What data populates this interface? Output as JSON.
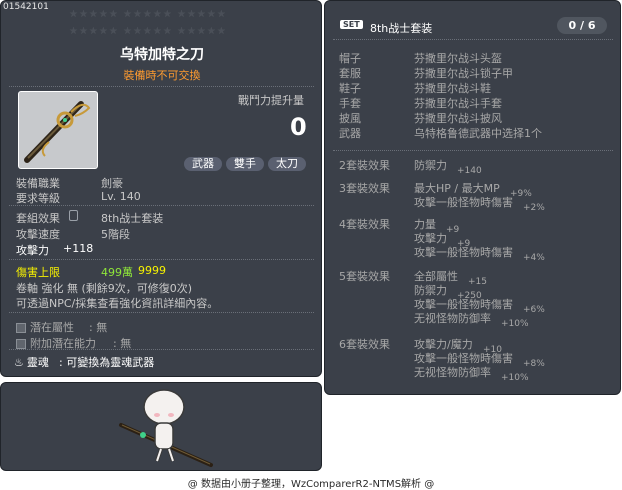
{
  "item_id": "01542101",
  "stars_row1": "★★★★★  ★★★★★  ★★★★★",
  "stars_row2": "★★★★★  ★★★★★  ★★★★★",
  "item_name": "乌特加特之刀",
  "item_tradable": "裝備時不可交換",
  "combat_power_label": "戰鬥力提升量",
  "combat_power_value": "0",
  "tags": [
    "武器",
    "雙手",
    "太刀"
  ],
  "job": {
    "label": "裝備職業",
    "value": "劍豪"
  },
  "level": {
    "label": "要求等級",
    "value": "Lv. 140"
  },
  "set_effect": {
    "label": "套組效果",
    "value": "8th战士套装"
  },
  "attack_speed": {
    "label": "攻擊速度",
    "value": "5階段"
  },
  "attack": {
    "label": "攻擊力",
    "value": "+118"
  },
  "damage_cap": {
    "label": "傷害上限",
    "value1": "499萬",
    "value2": "9999"
  },
  "scroll_line": "卷軸 強化 無 (剩餘9次，可修復0次)",
  "npc_line": "可透過NPC/採集查看強化資訊詳細內容。",
  "potential": {
    "label": "潛在屬性",
    "value": ": 無"
  },
  "add_potential": {
    "label": "附加潛在能力",
    "value": ": 無"
  },
  "soul": {
    "label": "靈魂",
    "value": ": 可變換為靈魂武器"
  },
  "set_panel": {
    "badge": "SET",
    "title": "8th战士套装",
    "count": "0 / 6",
    "parts": [
      {
        "slot": "帽子",
        "name": "芬撒里尔战斗头盔"
      },
      {
        "slot": "套服",
        "name": "芬撒里尔战斗锁子甲"
      },
      {
        "slot": "鞋子",
        "name": "芬撒里尔战斗鞋"
      },
      {
        "slot": "手套",
        "name": "芬撒里尔战斗手套"
      },
      {
        "slot": "披風",
        "name": "芬撒里尔战斗披风"
      },
      {
        "slot": "武器",
        "name": "乌特格鲁德武器中选择1个"
      }
    ],
    "effects": [
      {
        "label": "2套裝效果",
        "lines": [
          [
            "防禦力",
            "+140"
          ]
        ]
      },
      {
        "label": "3套裝效果",
        "lines": [
          [
            "最大HP / 最大MP",
            "+9%"
          ],
          [
            "攻擊一般怪物時傷害",
            "+2%"
          ]
        ]
      },
      {
        "label": "4套裝效果",
        "lines": [
          [
            "力量",
            "+9"
          ],
          [
            "攻擊力",
            "+9"
          ],
          [
            "攻擊一般怪物時傷害",
            "+4%"
          ]
        ]
      },
      {
        "label": "5套裝效果",
        "lines": [
          [
            "全部屬性",
            "+15"
          ],
          [
            "防禦力",
            "+250"
          ],
          [
            "攻擊一般怪物時傷害",
            "+6%"
          ],
          [
            "无视怪物防御率",
            "+10%"
          ]
        ]
      },
      {
        "label": "6套裝效果",
        "lines": [
          [
            "攻擊力/魔力",
            "+10"
          ],
          [
            "攻擊一般怪物時傷害",
            "+8%"
          ],
          [
            "无视怪物防御率",
            "+10%"
          ]
        ]
      }
    ]
  },
  "footer": "@ 数据由小册子整理，WzComparerR2-NTMS解析 @",
  "colors": {
    "panel": "#3b4049",
    "orange": "#ff9b2f",
    "yellow": "#f7f200",
    "green": "#8fe63a"
  }
}
